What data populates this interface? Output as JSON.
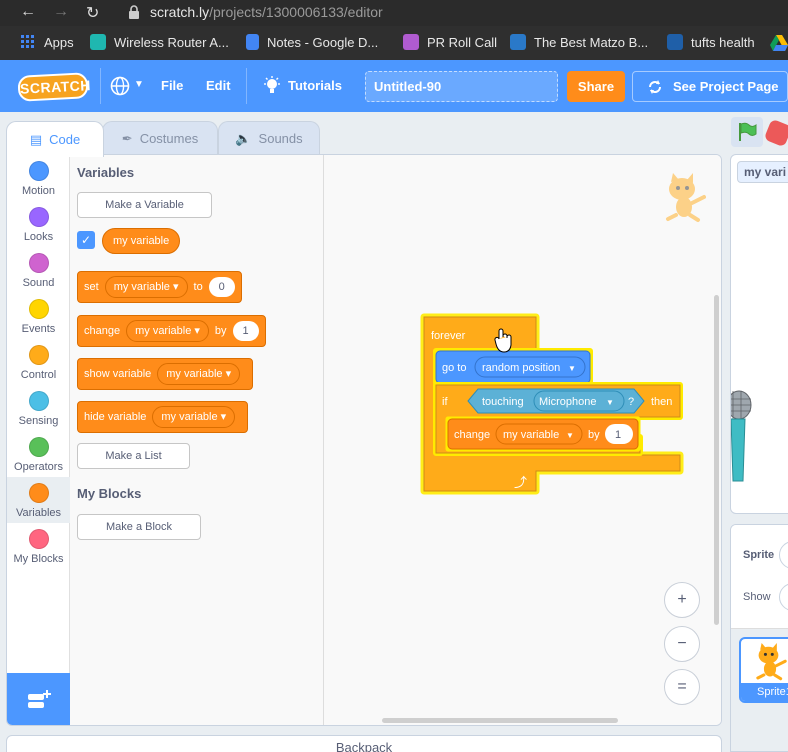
{
  "browser": {
    "url_host": "scratch.ly",
    "url_path": "/projects/1300006133/editor",
    "bookmarks": [
      {
        "label": "Apps",
        "color": "#4285f4"
      },
      {
        "label": "Wireless Router A...",
        "color": "#1fb7b0"
      },
      {
        "label": "Notes - Google D...",
        "color": "#4285f4"
      },
      {
        "label": "PR Roll Call",
        "color": "#b05bd0"
      },
      {
        "label": "The Best Matzo B...",
        "color": "#2a79c9"
      },
      {
        "label": "tufts health",
        "color": "#1f5fa8"
      }
    ]
  },
  "menu": {
    "logo_text": "SCRATCH",
    "file_label": "File",
    "edit_label": "Edit",
    "tutorials_label": "Tutorials",
    "project_title": "Untitled-90",
    "share_label": "Share",
    "see_project_label": "See Project Page"
  },
  "tabs": {
    "code": "Code",
    "costumes": "Costumes",
    "sounds": "Sounds"
  },
  "categories": [
    {
      "label": "Motion",
      "color": "#4c97ff"
    },
    {
      "label": "Looks",
      "color": "#9966ff"
    },
    {
      "label": "Sound",
      "color": "#cf63cf"
    },
    {
      "label": "Events",
      "color": "#ffd500"
    },
    {
      "label": "Control",
      "color": "#ffab19"
    },
    {
      "label": "Sensing",
      "color": "#4cbfe6"
    },
    {
      "label": "Operators",
      "color": "#59c059"
    },
    {
      "label": "Variables",
      "color": "#ff8c1a"
    },
    {
      "label": "My Blocks",
      "color": "#ff6680"
    }
  ],
  "palette": {
    "variables_heading": "Variables",
    "make_variable": "Make a Variable",
    "variable_name": "my variable",
    "set_block": {
      "verb": "set",
      "var": "my variable",
      "to": "to",
      "value": "0"
    },
    "change_block": {
      "verb": "change",
      "var": "my variable",
      "by": "by",
      "value": "1"
    },
    "show_block": {
      "verb": "show variable",
      "var": "my variable"
    },
    "hide_block": {
      "verb": "hide variable",
      "var": "my variable"
    },
    "make_list": "Make a List",
    "my_blocks_heading": "My Blocks",
    "make_block": "Make a Block"
  },
  "script": {
    "forever": "forever",
    "goto": "go to",
    "goto_target": "random position",
    "if": "if",
    "touching": "touching",
    "touching_target": "Microphone",
    "question": "?",
    "then": "then",
    "change": "change",
    "change_var": "my variable",
    "by": "by",
    "change_value": "1",
    "loop_arrow": "⤴"
  },
  "zoom": {
    "in": "+",
    "out": "−",
    "reset": "="
  },
  "backpack_label": "Backpack",
  "stage": {
    "monitor_label": "my vari"
  },
  "sprite_pane": {
    "sprite_label": "Sprite",
    "show_label": "Show",
    "thumb_caption": "Sprite1"
  }
}
